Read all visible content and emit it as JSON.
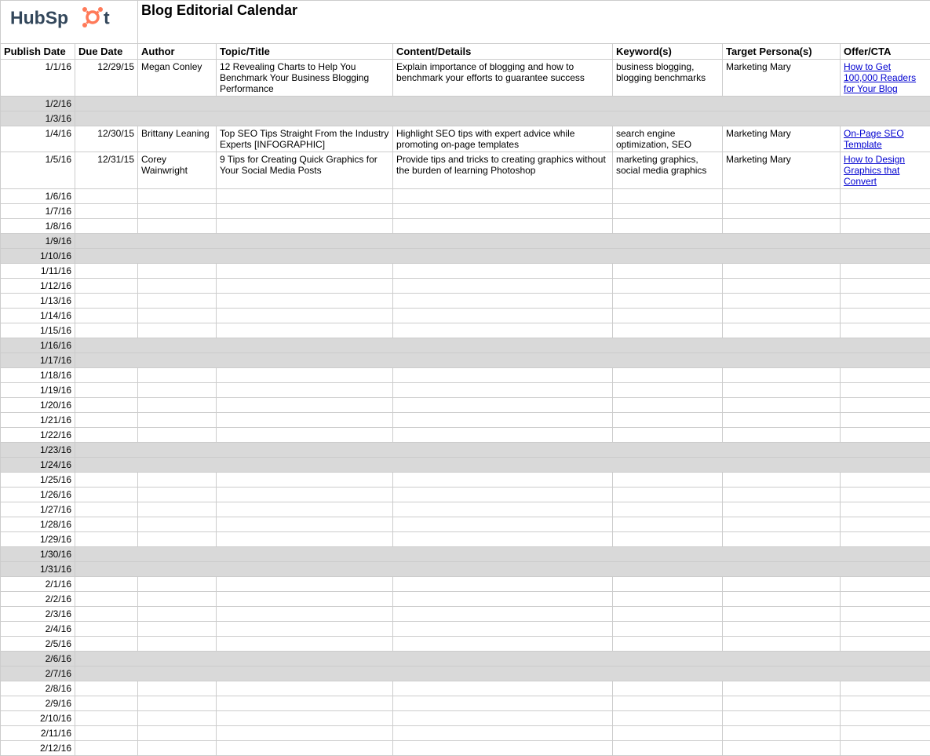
{
  "brand": "HubSpot",
  "title": "Blog Editorial Calendar",
  "headers": {
    "publish": "Publish Date",
    "due": "Due Date",
    "author": "Author",
    "topic": "Topic/Title",
    "content": "Content/Details",
    "keywords": "Keyword(s)",
    "persona": "Target Persona(s)",
    "offer": "Offer/CTA"
  },
  "rows": [
    {
      "publish": "1/1/16",
      "due": "12/29/15",
      "author": "Megan Conley",
      "topic": "12 Revealing Charts to Help You Benchmark Your Business Blogging Performance",
      "content": "Explain importance of blogging and how to benchmark your efforts to guarantee success",
      "keywords": "business blogging, blogging benchmarks",
      "persona": "Marketing Mary",
      "offer": "How to Get 100,000 Readers for Your Blog",
      "shaded": false,
      "link": true
    },
    {
      "publish": "1/2/16",
      "shaded": true
    },
    {
      "publish": "1/3/16",
      "shaded": true
    },
    {
      "publish": "1/4/16",
      "due": "12/30/15",
      "author": "Brittany Leaning",
      "topic": "Top SEO Tips Straight From the Industry Experts [INFOGRAPHIC]",
      "content": "Highlight SEO tips with expert advice while promoting on-page templates",
      "keywords": "search engine optimization, SEO",
      "persona": "Marketing Mary",
      "offer": "On-Page SEO Template",
      "shaded": false,
      "link": true
    },
    {
      "publish": "1/5/16",
      "due": "12/31/15",
      "author": "Corey Wainwright",
      "topic": "9 Tips for Creating Quick Graphics for Your Social Media Posts",
      "content": "Provide tips and tricks to creating graphics without the burden of learning Photoshop",
      "keywords": "marketing graphics, social media graphics",
      "persona": "Marketing Mary",
      "offer": "How to Design Graphics that Convert",
      "shaded": false,
      "link": true
    },
    {
      "publish": "1/6/16",
      "shaded": false
    },
    {
      "publish": "1/7/16",
      "shaded": false
    },
    {
      "publish": "1/8/16",
      "shaded": false
    },
    {
      "publish": "1/9/16",
      "shaded": true
    },
    {
      "publish": "1/10/16",
      "shaded": true
    },
    {
      "publish": "1/11/16",
      "shaded": false
    },
    {
      "publish": "1/12/16",
      "shaded": false
    },
    {
      "publish": "1/13/16",
      "shaded": false
    },
    {
      "publish": "1/14/16",
      "shaded": false
    },
    {
      "publish": "1/15/16",
      "shaded": false
    },
    {
      "publish": "1/16/16",
      "shaded": true
    },
    {
      "publish": "1/17/16",
      "shaded": true
    },
    {
      "publish": "1/18/16",
      "shaded": false
    },
    {
      "publish": "1/19/16",
      "shaded": false
    },
    {
      "publish": "1/20/16",
      "shaded": false
    },
    {
      "publish": "1/21/16",
      "shaded": false
    },
    {
      "publish": "1/22/16",
      "shaded": false
    },
    {
      "publish": "1/23/16",
      "shaded": true
    },
    {
      "publish": "1/24/16",
      "shaded": true
    },
    {
      "publish": "1/25/16",
      "shaded": false
    },
    {
      "publish": "1/26/16",
      "shaded": false
    },
    {
      "publish": "1/27/16",
      "shaded": false
    },
    {
      "publish": "1/28/16",
      "shaded": false
    },
    {
      "publish": "1/29/16",
      "shaded": false
    },
    {
      "publish": "1/30/16",
      "shaded": true
    },
    {
      "publish": "1/31/16",
      "shaded": true
    },
    {
      "publish": "2/1/16",
      "shaded": false
    },
    {
      "publish": "2/2/16",
      "shaded": false
    },
    {
      "publish": "2/3/16",
      "shaded": false
    },
    {
      "publish": "2/4/16",
      "shaded": false
    },
    {
      "publish": "2/5/16",
      "shaded": false
    },
    {
      "publish": "2/6/16",
      "shaded": true
    },
    {
      "publish": "2/7/16",
      "shaded": true
    },
    {
      "publish": "2/8/16",
      "shaded": false
    },
    {
      "publish": "2/9/16",
      "shaded": false
    },
    {
      "publish": "2/10/16",
      "shaded": false
    },
    {
      "publish": "2/11/16",
      "shaded": false
    },
    {
      "publish": "2/12/16",
      "shaded": false
    }
  ]
}
